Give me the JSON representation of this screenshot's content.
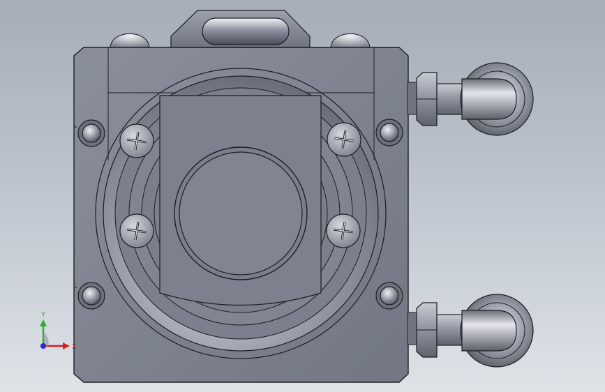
{
  "viewport": {
    "background_top": "#a6adb8",
    "background_bottom": "#dfe3e8"
  },
  "model": {
    "body_color": "#7e838f",
    "edge_color": "#1c1e24",
    "highlight_color": "#e6e8ee",
    "features": [
      "square-housing",
      "top-slot-tab",
      "top-mounting-bosses",
      "circular-lens-ring",
      "rectangular-cover-plate",
      "center-disc",
      "phillips-screw-icon",
      "phillips-screw-icon",
      "phillips-screw-icon",
      "phillips-screw-icon",
      "corner-hole",
      "corner-hole",
      "corner-hole",
      "corner-hole",
      "hose-fitting-upper",
      "hose-fitting-lower"
    ]
  },
  "triad": {
    "y_label": "Y",
    "x_label": "X",
    "y_color": "#2fae2f",
    "x_color": "#d42020",
    "z_color": "#2030d0"
  }
}
